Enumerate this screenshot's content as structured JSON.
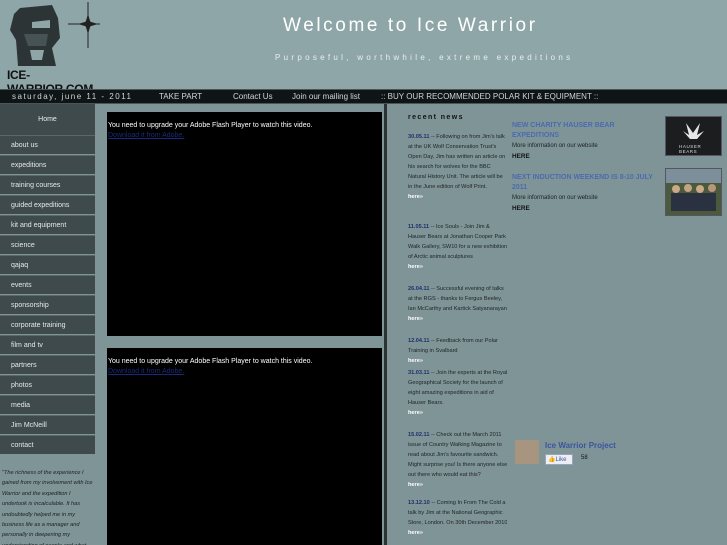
{
  "header": {
    "logo_text": "ICE-WARRIOR.COM",
    "title": "Welcome to Ice Warrior",
    "tagline": "Purposeful, worthwhile, extreme expeditions"
  },
  "navbar": {
    "date": "saturday, june 11 - 2011",
    "take_part": "TAKE PART",
    "contact_us": "Contact Us",
    "mailing_list": "Join our mailing list",
    "buy": ":: BUY OUR RECOMMENDED POLAR KIT & EQUIPMENT ::"
  },
  "sidebar": {
    "home": "Home",
    "items": [
      {
        "label": "about us"
      },
      {
        "label": "expeditions"
      },
      {
        "label": "training courses"
      },
      {
        "label": "guided expeditions"
      },
      {
        "label": "kit and equipment"
      },
      {
        "label": "science"
      },
      {
        "label": "qajaq"
      },
      {
        "label": "events"
      },
      {
        "label": "sponsorship"
      },
      {
        "label": "corporate training"
      },
      {
        "label": "film and tv"
      },
      {
        "label": "partners"
      },
      {
        "label": "photos"
      },
      {
        "label": "media"
      },
      {
        "label": "Jim McNeill"
      },
      {
        "label": "contact"
      }
    ],
    "quote": "\"The richness of the experience I gained from my involvement with Ice Warrior and the expedition I undertook is incalculable. It has undoubtedly helped me in my business life as a manager and personally in deepening my understanding of people and what drives them to achieve"
  },
  "videos": [
    {
      "message": "You need to upgrade your Adobe Flash Player to watch this video.",
      "link": "Download it from Adobe."
    },
    {
      "message": "You need to upgrade your Adobe Flash Player to watch this video.",
      "link": "Download it from Adobe."
    }
  ],
  "news": {
    "title": "recent news",
    "items": [
      {
        "date": "30.05.11",
        "text": " -- Following on from Jim's talk at the UK Wolf Conservation Trust's Open Day, Jim has written an article on his search for wolves for the BBC Natural History Unit. The article will be in the June edition of Wolf Print.",
        "here": "here»"
      },
      {
        "date": "11.05.11",
        "text": " -- Ice Souls - Join Jim & Hauser Bears at Jonathan Cooper Park Walk Gallery, SW10 for a new exhibition of Arctic animal sculptures",
        "here": "here»"
      },
      {
        "date": "26.04.11",
        "text": " -- Successful evening of talks at the RGS - thanks to Fergus Beeley, Ian McCarthy and Kartick Satyanarayan",
        "here": "here»"
      },
      {
        "date": "12.04.11",
        "text": " -- Feedback from our Polar Training in Svalbard",
        "here": "here»"
      },
      {
        "date": "31.03.11",
        "text": " -- Join the experts at the Royal Geographical Society for the launch of eight amazing expeditions in aid of Hauser Bears.",
        "here": "here»"
      },
      {
        "date": "15.02.11",
        "text": " -- Check out the March 2011 issue of Country Walking Magazine to read about Jim's favourite sandwich. Might surprise you! Is there anyone else out there who would eat this?",
        "here": "here»"
      },
      {
        "date": "13.12.10",
        "text": " -- Coming In From The Cold a talk by Jim at the National Geographic Store, London. On 30th December 2010",
        "here": "here»"
      }
    ]
  },
  "promos": [
    {
      "title": "NEW CHARITY HAUSER BEAR EXPEDITIONS",
      "text": "More information on our website",
      "here": "HERE",
      "thumb_text": "HAUSER BEARS"
    },
    {
      "title": "NEXT INDUCTION WEEKEND IS 8-10 JULY 2011",
      "text": "More information on our website",
      "here": "HERE"
    }
  ],
  "facebook": {
    "title": "Ice Warrior Project",
    "like": "Like",
    "count": "58"
  }
}
